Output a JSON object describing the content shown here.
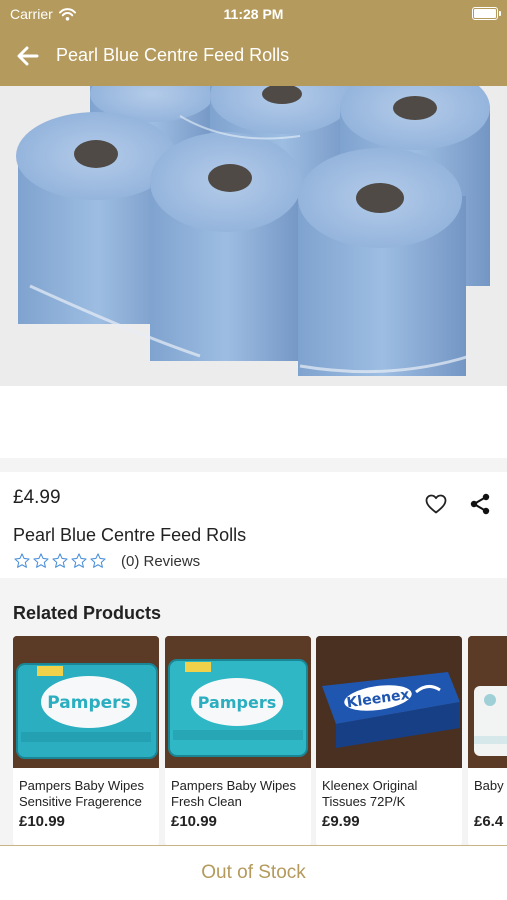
{
  "status_bar": {
    "carrier": "Carrier",
    "time": "11:28 PM"
  },
  "nav": {
    "title": "Pearl Blue Centre Feed Rolls",
    "back_icon": "arrow-left-icon"
  },
  "product": {
    "price": "£4.99",
    "name": "Pearl Blue Centre Feed Rolls",
    "rating": 0,
    "max_rating": 5,
    "reviews_label": "(0) Reviews"
  },
  "related": {
    "title": "Related Products",
    "items": [
      {
        "name": "Pampers Baby Wipes Sensitive Fragerence",
        "price": "£10.99"
      },
      {
        "name": "Pampers Baby Wipes Fresh Clean",
        "price": "£10.99"
      },
      {
        "name": "Kleenex Original Tissues 72P/K",
        "price": "£9.99"
      },
      {
        "name": "Baby Cham",
        "price": "£6.4"
      }
    ]
  },
  "footer": {
    "status": "Out of Stock"
  },
  "colors": {
    "brand": "#b49a5c",
    "star_outline": "#4a90d9",
    "background": "#f4f4f4"
  }
}
